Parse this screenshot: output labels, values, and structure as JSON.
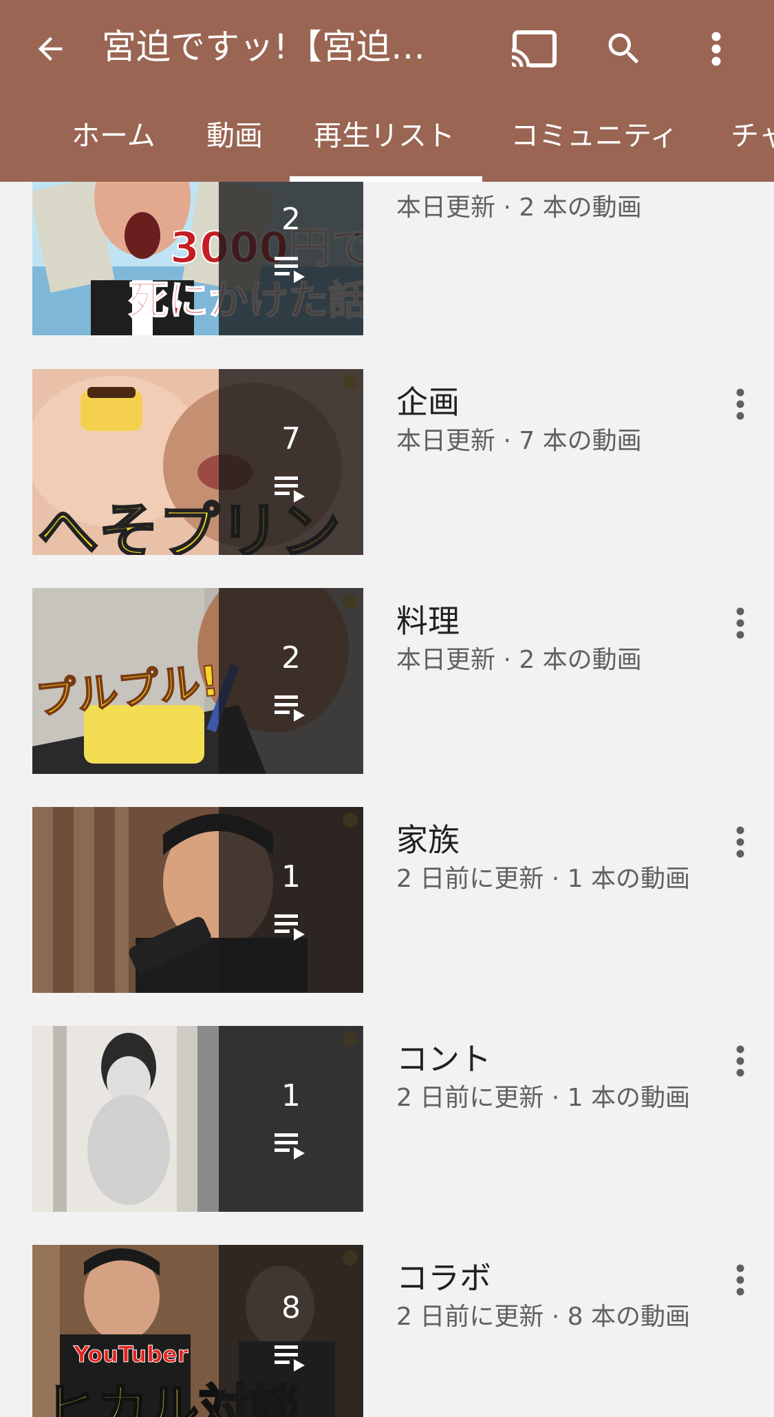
{
  "header": {
    "title": "宮迫ですッ!【宮迫…",
    "back_icon": "arrow-back-icon",
    "cast_icon": "cast-icon",
    "search_icon": "search-icon",
    "more_icon": "more-vert-icon",
    "bar_color": "#9a6553"
  },
  "tabs": [
    {
      "label": "ホーム"
    },
    {
      "label": "動画"
    },
    {
      "label": "再生リスト",
      "selected": true
    },
    {
      "label": "コミュニティ"
    },
    {
      "label": "チャ"
    }
  ],
  "playlists": [
    {
      "title": "",
      "meta": "本日更新 · 2 本の動画",
      "count": "2",
      "thumb_text_1": "3000円で",
      "thumb_text_2": "死にかけた話"
    },
    {
      "title": "企画",
      "meta": "本日更新 · 7 本の動画",
      "count": "7",
      "thumb_text_1": "へそプリン"
    },
    {
      "title": "料理",
      "meta": "本日更新 · 2 本の動画",
      "count": "2",
      "thumb_text_1": "プルプル!"
    },
    {
      "title": "家族",
      "meta": "2 日前に更新 · 1 本の動画",
      "count": "1"
    },
    {
      "title": "コント",
      "meta": "2 日前に更新 · 1 本の動画",
      "count": "1"
    },
    {
      "title": "コラボ",
      "meta": "2 日前に更新 · 8 本の動画",
      "count": "8",
      "thumb_text_1": "YouTuber",
      "thumb_text_2": "ヒカル対談"
    }
  ]
}
